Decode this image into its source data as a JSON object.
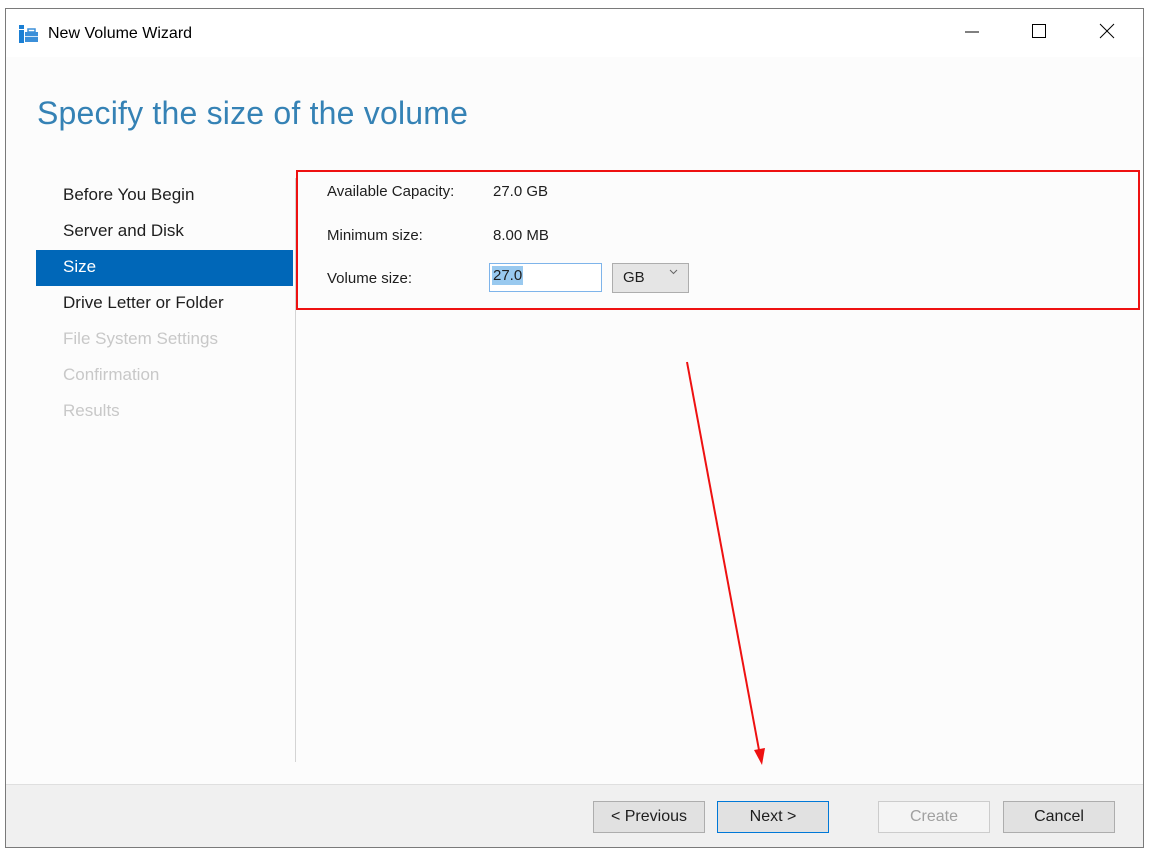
{
  "window": {
    "title": "New Volume Wizard",
    "icon": "server-volume-icon",
    "controls": {
      "minimize": "minimize-icon",
      "maximize": "maximize-icon",
      "close": "close-icon"
    }
  },
  "page": {
    "title": "Specify the size of the volume"
  },
  "nav": {
    "items": [
      {
        "label": "Before You Begin",
        "state": "enabled"
      },
      {
        "label": "Server and Disk",
        "state": "enabled"
      },
      {
        "label": "Size",
        "state": "active"
      },
      {
        "label": "Drive Letter or Folder",
        "state": "enabled"
      },
      {
        "label": "File System Settings",
        "state": "disabled"
      },
      {
        "label": "Confirmation",
        "state": "disabled"
      },
      {
        "label": "Results",
        "state": "disabled"
      }
    ]
  },
  "form": {
    "available_capacity_label": "Available Capacity:",
    "available_capacity_value": "27.0 GB",
    "minimum_size_label": "Minimum size:",
    "minimum_size_value": "8.00 MB",
    "volume_size_label": "Volume size:",
    "volume_size_value": "27.0",
    "unit_selected": "GB"
  },
  "footer": {
    "previous_label": "< Previous",
    "next_label": "Next >",
    "create_label": "Create",
    "cancel_label": "Cancel"
  },
  "annotations": {
    "highlight_color": "#ee1111",
    "arrow_color": "#ee1111"
  },
  "colors": {
    "accent": "#0067b8",
    "title_blue": "#3582b5"
  }
}
